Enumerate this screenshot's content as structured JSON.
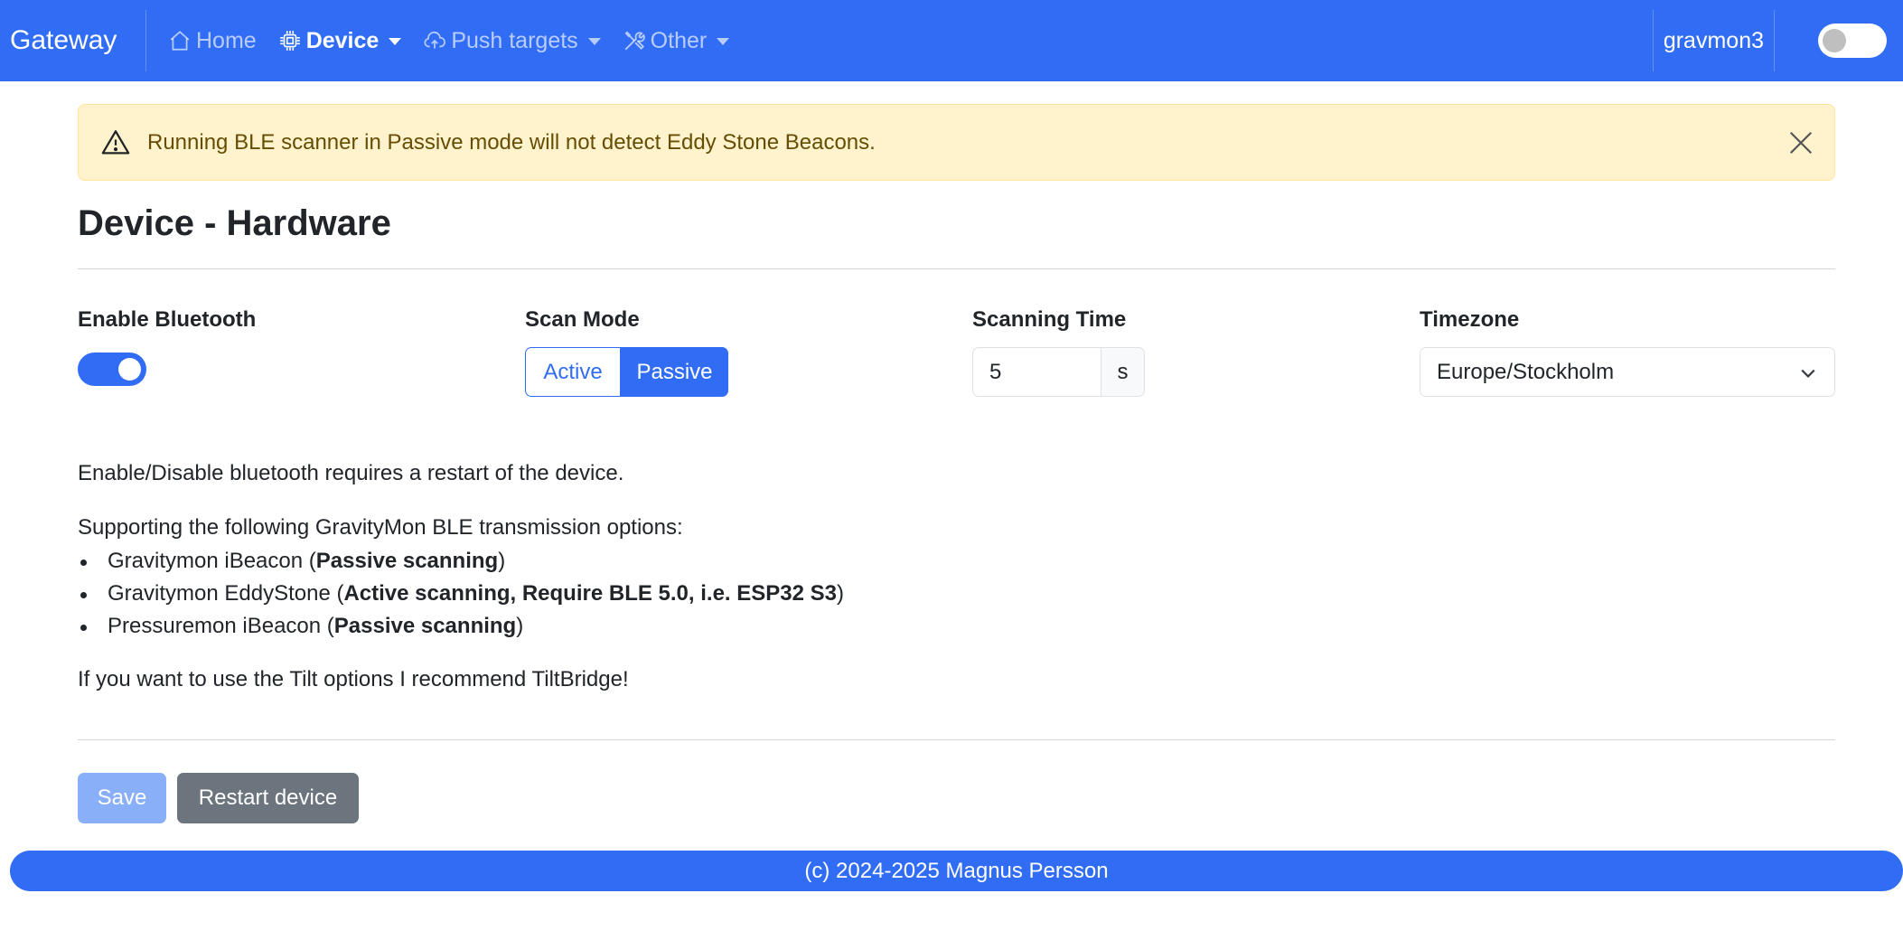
{
  "navbar": {
    "brand": "Gateway",
    "items": [
      {
        "label": "Home",
        "icon": "house-icon",
        "active": false,
        "dropdown": false
      },
      {
        "label": "Device",
        "icon": "cpu-icon",
        "active": true,
        "dropdown": true
      },
      {
        "label": "Push targets",
        "icon": "cloud-upload-icon",
        "active": false,
        "dropdown": true
      },
      {
        "label": "Other",
        "icon": "tools-icon",
        "active": false,
        "dropdown": true
      }
    ],
    "hostname": "gravmon3",
    "theme_toggle_on": false
  },
  "alert": {
    "icon": "warning-triangle-icon",
    "text": "Running BLE scanner in Passive mode will not detect Eddy Stone Beacons."
  },
  "page_title": "Device - Hardware",
  "fields": {
    "bluetooth": {
      "label": "Enable Bluetooth",
      "enabled": true
    },
    "scan_mode": {
      "label": "Scan Mode",
      "options": [
        "Active",
        "Passive"
      ],
      "selected": "Passive"
    },
    "scan_time": {
      "label": "Scanning Time",
      "value": "5",
      "unit": "s"
    },
    "timezone": {
      "label": "Timezone",
      "value": "Europe/Stockholm"
    }
  },
  "info": {
    "restart_note": "Enable/Disable bluetooth requires a restart of the device.",
    "support_intro": "Supporting the following GravityMon BLE transmission options:",
    "options": [
      {
        "name": "Gravitymon iBeacon (",
        "detail": "Passive scanning",
        "tail": ")"
      },
      {
        "name": "Gravitymon EddyStone (",
        "detail": "Active scanning, Require BLE 5.0, i.e. ESP32 S3",
        "tail": ")"
      },
      {
        "name": "Pressuremon iBeacon (",
        "detail": "Passive scanning",
        "tail": ")"
      }
    ],
    "tilt_note": "If you want to use the Tilt options I recommend TiltBridge!"
  },
  "buttons": {
    "save": "Save",
    "restart": "Restart device"
  },
  "footer": "(c) 2024-2025 Magnus Persson",
  "colors": {
    "primary": "#316df4",
    "alert_bg": "#fff3cd",
    "alert_text": "#664d03",
    "secondary": "#6c757d"
  }
}
